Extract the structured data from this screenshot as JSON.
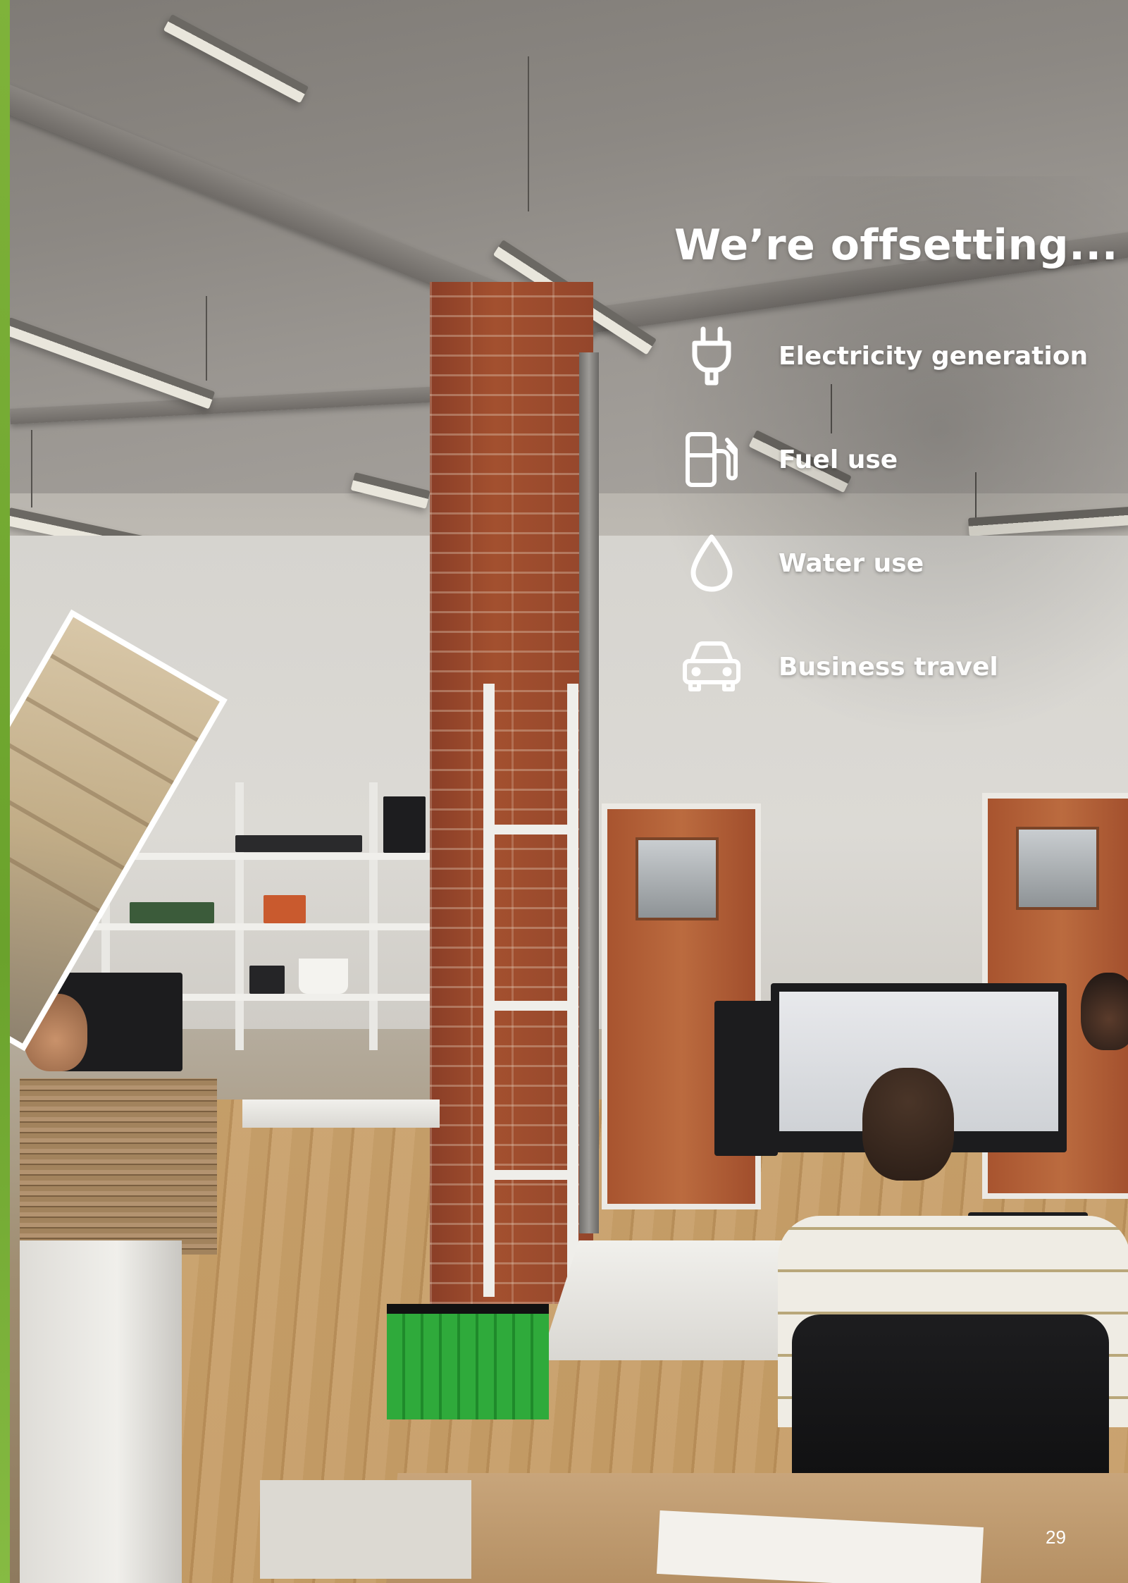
{
  "heading": "We’re offsetting...",
  "items": [
    {
      "icon": "plug-icon",
      "label": "Electricity generation"
    },
    {
      "icon": "fuel-pump-icon",
      "label": "Fuel use"
    },
    {
      "icon": "water-drop-icon",
      "label": "Water use"
    },
    {
      "icon": "car-icon",
      "label": "Business travel"
    }
  ],
  "page_number": "29",
  "colors": {
    "text": "#ffffff",
    "edge_green": "#7fb33a"
  }
}
